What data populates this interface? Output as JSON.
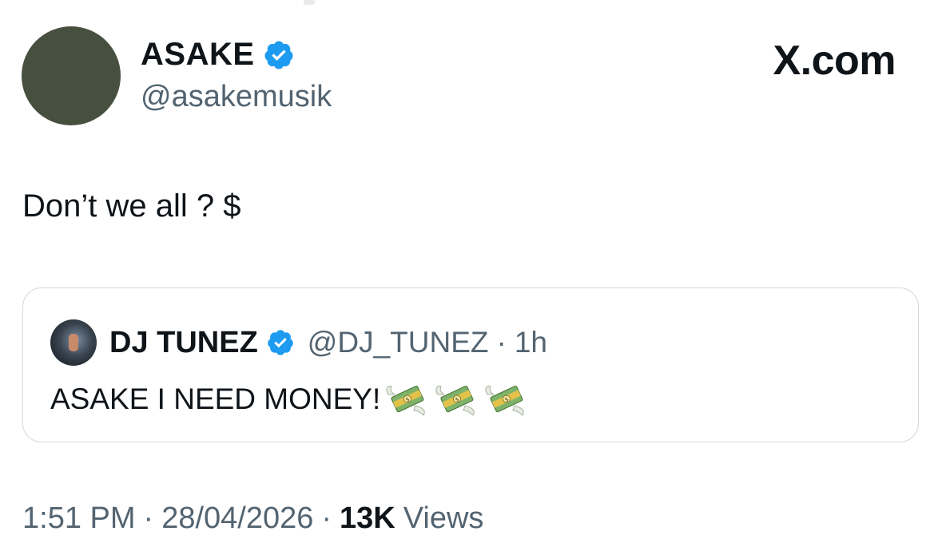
{
  "author": {
    "display_name": "ASAKE",
    "handle": "@asakemusik",
    "verified_icon": "verified-badge-icon"
  },
  "brand": {
    "label": "X.com"
  },
  "tweet": {
    "text": "Don’t we all ? $"
  },
  "quoted_tweet": {
    "display_name": "DJ TUNEZ",
    "handle": "@DJ_TUNEZ",
    "separator": "·",
    "time": "1h",
    "text": "ASAKE I NEED MONEY!",
    "emojis": [
      "money-with-wings-icon",
      "money-with-wings-icon",
      "money-with-wings-icon"
    ]
  },
  "meta": {
    "time": "1:51 PM",
    "sep1": "·",
    "date": "28/04/2026",
    "sep2": "·",
    "views_count": "13K",
    "views_label": "Views"
  },
  "colors": {
    "accent_blue": "#1d9bf0",
    "secondary_text": "#536471",
    "border": "#cfd9de",
    "avatar_bg": "#474f3f"
  }
}
